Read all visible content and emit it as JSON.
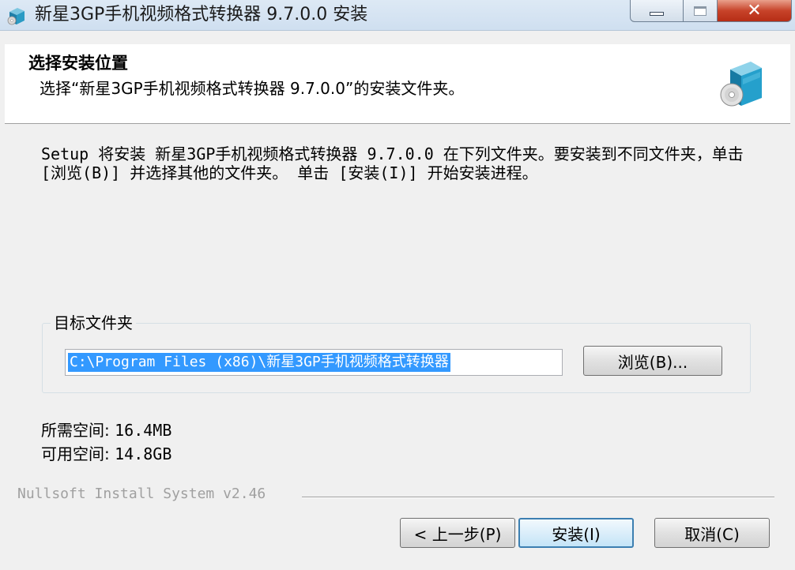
{
  "window": {
    "title": "新星3GP手机视频格式转换器 9.7.0.0 安装",
    "app_icon": "installer-box-icon"
  },
  "controls": {
    "minimize_icon": "minimize-icon",
    "maximize_icon": "maximize-icon",
    "close_glyph": "✕"
  },
  "header": {
    "title": "选择安装位置",
    "subtitle": "选择“新星3GP手机视频格式转换器 9.7.0.0”的安装文件夹。",
    "icon": "box-with-disc-icon"
  },
  "body": {
    "description": "Setup 将安装 新星3GP手机视频格式转换器 9.7.0.0 在下列文件夹。要安装到不同文件夹，单击 [浏览(B)] 并选择其他的文件夹。 单击 [安装(I)] 开始安装进程。"
  },
  "destination": {
    "group_label": "目标文件夹",
    "path_value": "C:\\Program Files (x86)\\新星3GP手机视频格式转换器",
    "browse_label": "浏览(B)..."
  },
  "space": {
    "required_label": "所需空间:",
    "required_value": "16.4MB",
    "available_label": "可用空间:",
    "available_value": "14.8GB"
  },
  "footer": {
    "branding": "Nullsoft Install System v2.46",
    "back_label": "< 上一步(P)",
    "install_label": "安装(I)",
    "cancel_label": "取消(C)"
  },
  "colors": {
    "selection": "#3399ff",
    "close_button": "#c7432a",
    "header_bg": "#ffffff",
    "window_bg": "#f0f0f0"
  }
}
